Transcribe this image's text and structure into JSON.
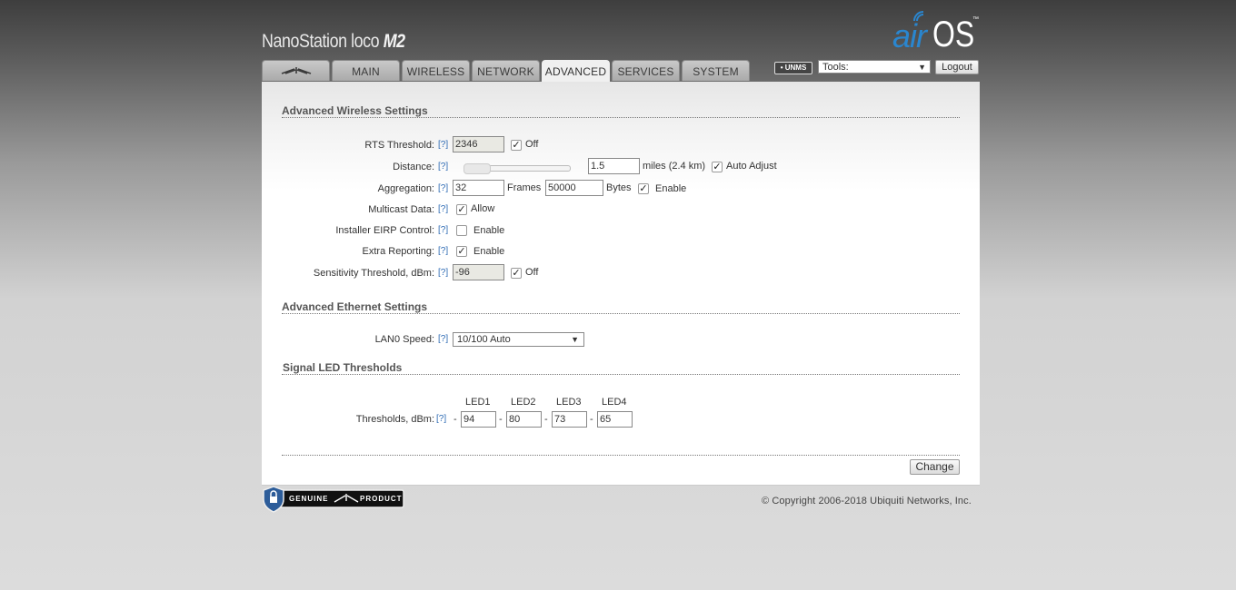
{
  "header": {
    "product_prefix": "NanoStation",
    "product_suffix": "loco",
    "product_model": "M2",
    "logo_air": "air",
    "logo_os": "OS",
    "logo_tm": "™"
  },
  "tabs": [
    {
      "label": "",
      "icon": "ubiquiti-logo-icon"
    },
    {
      "label": "MAIN"
    },
    {
      "label": "WIRELESS"
    },
    {
      "label": "NETWORK"
    },
    {
      "label": "ADVANCED",
      "active": true
    },
    {
      "label": "SERVICES"
    },
    {
      "label": "SYSTEM"
    }
  ],
  "topbar": {
    "unms_label": "UNMS",
    "tools_value": "Tools:",
    "logout_label": "Logout"
  },
  "help_label": "[?]",
  "advanced_wireless": {
    "title": "Advanced Wireless Settings",
    "rts_label": "RTS Threshold:",
    "rts_value": "2346",
    "rts_off_checked": true,
    "rts_off_label": "Off",
    "distance_label": "Distance:",
    "distance_value": "1.5",
    "distance_units": "miles (2.4 km)",
    "auto_adjust_checked": true,
    "auto_adjust_label": "Auto Adjust",
    "aggregation_label": "Aggregation:",
    "aggregation_frames": "32",
    "frames_label": "Frames",
    "aggregation_bytes": "50000",
    "bytes_label": "Bytes",
    "aggregation_enable_checked": true,
    "enable_label": "Enable",
    "multicast_label": "Multicast Data:",
    "multicast_checked": true,
    "allow_label": "Allow",
    "eirp_label": "Installer EIRP Control:",
    "eirp_checked": false,
    "extra_reporting_label": "Extra Reporting:",
    "extra_reporting_checked": true,
    "sensitivity_label": "Sensitivity Threshold, dBm:",
    "sensitivity_value": "-96",
    "sensitivity_off_checked": true
  },
  "advanced_ethernet": {
    "title": "Advanced Ethernet Settings",
    "lan0_label": "LAN0 Speed:",
    "lan0_value": "10/100 Auto"
  },
  "signal_led": {
    "title": "Signal LED Thresholds",
    "headers": [
      "LED1",
      "LED2",
      "LED3",
      "LED4"
    ],
    "thresholds_label": "Thresholds, dBm:",
    "dash": "-",
    "values": [
      "94",
      "80",
      "73",
      "65"
    ]
  },
  "change_label": "Change",
  "footer": {
    "genuine_left": "GENUINE",
    "genuine_right": "PRODUCT",
    "copyright": "© Copyright 2006-2018 Ubiquiti Networks, Inc."
  }
}
